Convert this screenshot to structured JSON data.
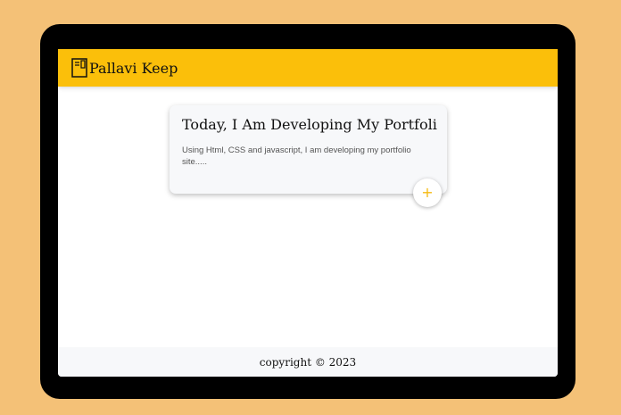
{
  "header": {
    "title": "Pallavi Keep",
    "icon": "notebook-icon",
    "accent_color": "#fbbf0a"
  },
  "notes": [
    {
      "title": "Today, I Am Developing My Portfoli",
      "content": "Using Html, CSS and javascript, I am developing my portfolio site.....",
      "add_label": "+"
    }
  ],
  "footer": {
    "text": "copyright © 2023"
  }
}
